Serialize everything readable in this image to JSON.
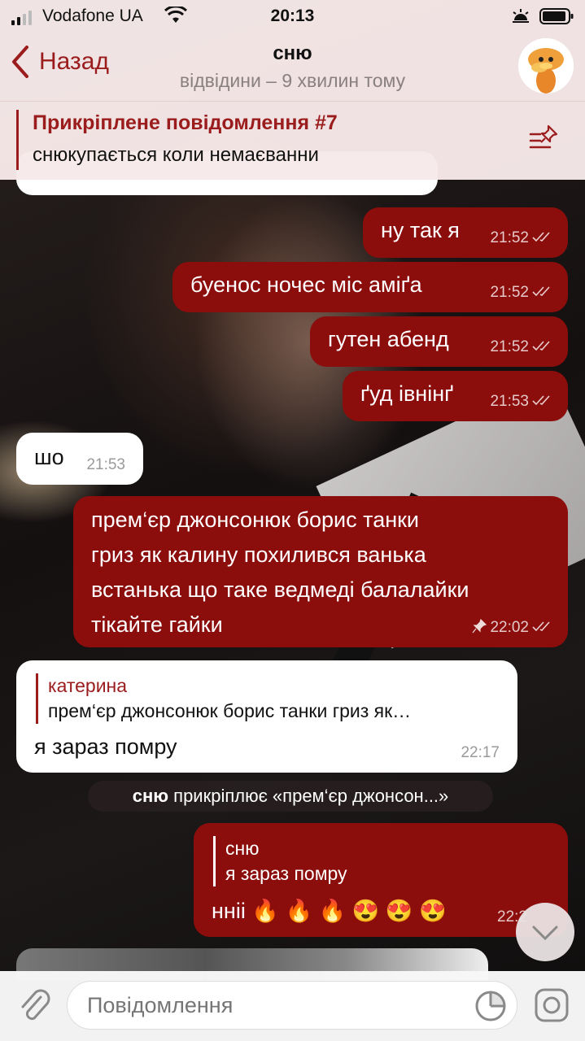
{
  "status_bar": {
    "carrier": "Vodafone UA",
    "time": "20:13"
  },
  "header": {
    "back_label": "Назад",
    "title": "сню",
    "subtitle": "відвідини – 9 хвилин тому"
  },
  "pinned": {
    "title": "Прикріплене повідомлення #7",
    "text": "снюкупається коли немаєванни"
  },
  "messages": [
    {
      "dir": "out",
      "text": "ну так я",
      "time": "21:52"
    },
    {
      "dir": "out",
      "text": "буенос ночес міс аміґа",
      "time": "21:52"
    },
    {
      "dir": "out",
      "text": "гутен абенд",
      "time": "21:52"
    },
    {
      "dir": "out",
      "text": "ґуд івнінґ",
      "time": "21:53"
    },
    {
      "dir": "in",
      "text": "шо",
      "time": "21:53"
    },
    {
      "dir": "out",
      "lines": [
        "прем‘єр джонсонюк борис танки",
        "гриз як калину похилився ванька",
        "встанька що таке ведмеді балалайки",
        "тікайте гайки"
      ],
      "time": "22:02"
    },
    {
      "dir": "in",
      "reply_name": "катерина",
      "reply_text": "прем‘єр джонсонюк борис танки гриз як…",
      "text": "я зараз помру",
      "time": "22:17"
    },
    {
      "dir": "out",
      "reply_name": "сню",
      "reply_text": "я зараз помру",
      "text": "нніі",
      "emoji": "🔥 🔥 🔥 😍 😍 😍",
      "time": "22:2"
    }
  ],
  "service_message": {
    "actor": "сню",
    "action": "прикріплює «прем‘єр джонсон...»"
  },
  "input": {
    "placeholder": "Повідомлення"
  },
  "colors": {
    "accent": "#9b1c1c",
    "outgoing_bubble": "#8b0d0c",
    "incoming_bubble": "#ffffff"
  }
}
